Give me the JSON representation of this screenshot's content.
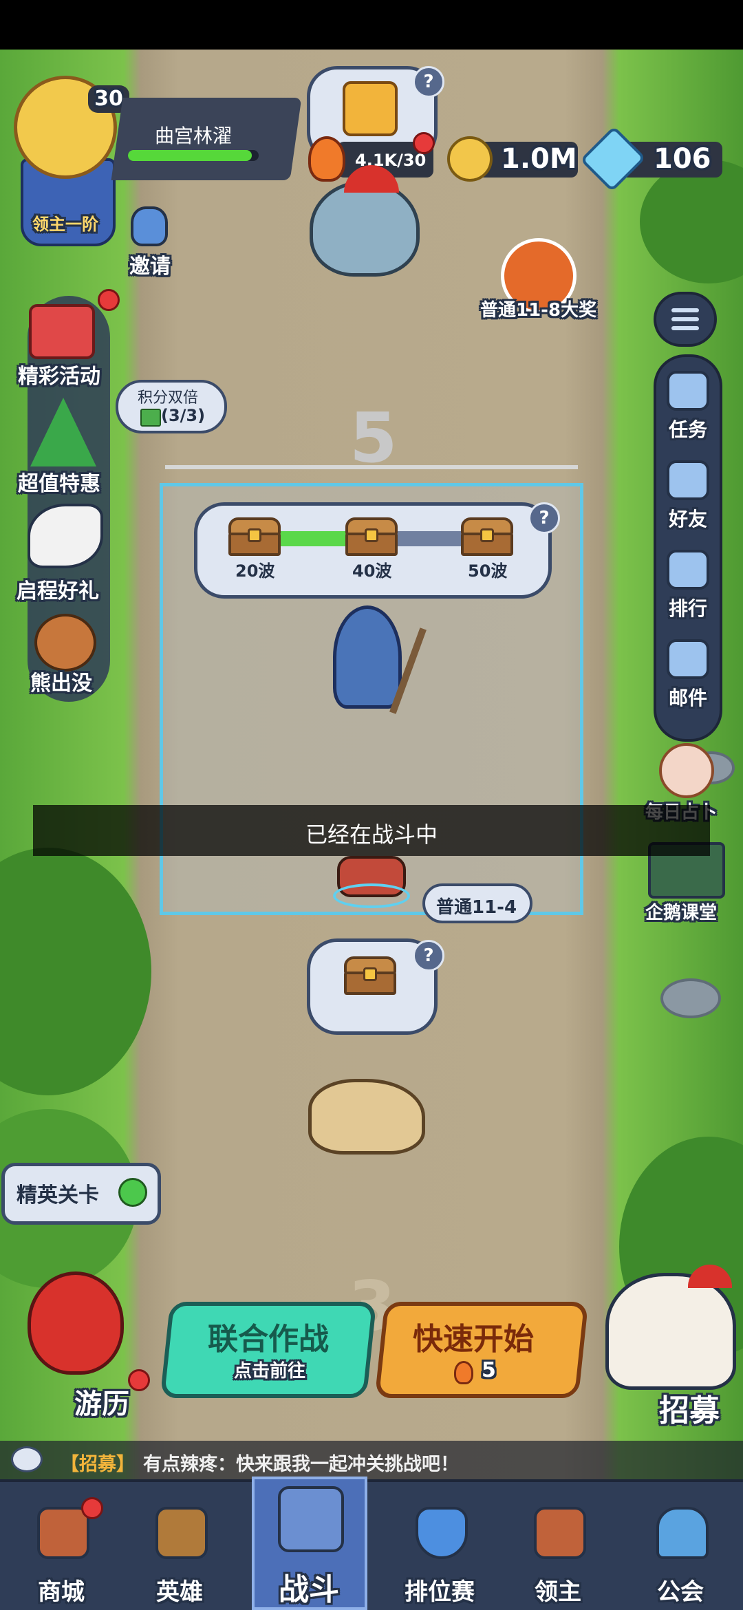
{
  "player": {
    "level": "30",
    "name": "曲宫林濯",
    "rank_badge": "领主一阶"
  },
  "resources": {
    "stamina": "4.1K/30",
    "gold": "1.0M",
    "gems": "106"
  },
  "invite_label": "邀请",
  "grand_prize_label": "普通11-8大奖",
  "left_menu": [
    {
      "label": "精彩活动",
      "icon": "gift-box-icon"
    },
    {
      "label": "超值特惠",
      "icon": "christmas-tree-icon"
    },
    {
      "label": "启程好礼",
      "icon": "phoenix-icon"
    },
    {
      "label": "熊出没",
      "icon": "bear-icon"
    }
  ],
  "double_points": {
    "title": "积分双倍",
    "count": "(3/3)"
  },
  "wave_number_top": "5",
  "wave_rewards": [
    {
      "label": "20波"
    },
    {
      "label": "40波"
    },
    {
      "label": "50波"
    }
  ],
  "wave_progress": 0.42,
  "right_menu": [
    {
      "label": "任务",
      "icon": "task-clipboard-icon"
    },
    {
      "label": "好友",
      "icon": "friends-icon"
    },
    {
      "label": "排行",
      "icon": "ranking-podium-icon"
    },
    {
      "label": "邮件",
      "icon": "mail-envelope-icon"
    }
  ],
  "daily_fortune_label": "每日占卜",
  "penguin_class_label": "企鹅课堂",
  "toast": "已经在战斗中",
  "stage_tag": "普通11-4",
  "elite_stage_label": "精英关卡",
  "travel_label": "游历",
  "recruit_label": "招募",
  "wave_number_bottom": "3",
  "coop_button": {
    "title": "联合作战",
    "subtitle": "点击前往"
  },
  "quick_start_button": {
    "title": "快速开始",
    "cost": "5"
  },
  "chat": {
    "tag": "【招募】",
    "message": "有点辣疼：快来跟我一起冲关挑战吧！"
  },
  "bottom_nav": [
    {
      "label": "商城",
      "icon": "shop-icon",
      "color": "#c0623a"
    },
    {
      "label": "英雄",
      "icon": "hero-card-icon",
      "color": "#b07a3a"
    },
    {
      "label": "战斗",
      "icon": "battle-weapons-icon",
      "color": "#6b8fd1"
    },
    {
      "label": "排位赛",
      "icon": "rank-shield-icon",
      "color": "#4d8fe0"
    },
    {
      "label": "领主",
      "icon": "lord-banner-icon",
      "color": "#c0623a"
    },
    {
      "label": "公会",
      "icon": "guild-castle-icon",
      "color": "#5aa3e0"
    }
  ],
  "colors": {
    "nav_bg": "#2f3d57",
    "nav_active": "#4c6fb8",
    "coop_green": "#3fd8b4",
    "quick_orange": "#f2a93b",
    "toast_bg": "#000000"
  }
}
